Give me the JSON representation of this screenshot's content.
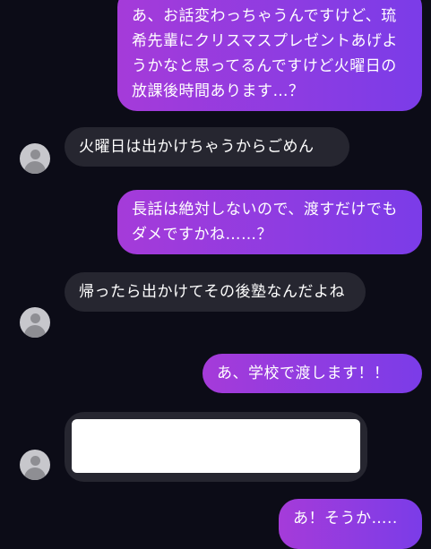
{
  "messages": [
    {
      "from": "me",
      "text": "あ、お話変わっちゃうんですけど、琉希先輩にクリスマスプレゼントあげようかなと思ってるんですけど火曜日の放課後時間あります…？"
    },
    {
      "from": "other",
      "text": "火曜日は出かけちゃうからごめん"
    },
    {
      "from": "me",
      "text": "長話は絶対しないので、渡すだけでもダメですかね……？"
    },
    {
      "from": "other",
      "text": "帰ったら出かけてその後塾なんだよね"
    },
    {
      "from": "me",
      "text": "あ、学校で渡します！！"
    },
    {
      "from": "other",
      "text": ""
    },
    {
      "from": "me",
      "text": "あ！そうか….."
    }
  ],
  "colors": {
    "background": "#0c0c17",
    "sent_gradient_start": "#a53bd9",
    "sent_gradient_end": "#7b3ce8",
    "received": "#262630",
    "avatar": "#c7c7cc"
  },
  "icons": {
    "avatar": "default-user-avatar-icon"
  }
}
